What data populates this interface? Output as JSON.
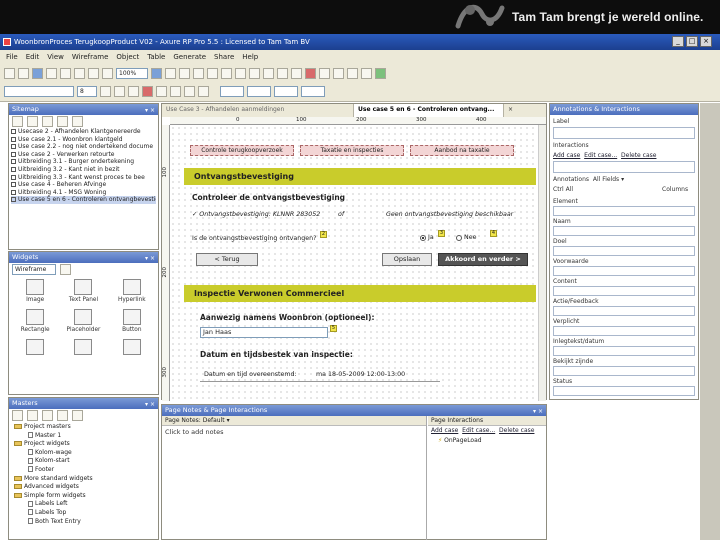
{
  "banner": {
    "tagline": "Tam Tam brengt je wereld online."
  },
  "window": {
    "title": "WoonbronProces TerugkoopProduct V02 - Axure RP Pro 5.5 : Licensed to Tam Tam BV",
    "controls": [
      "_",
      "□",
      "×"
    ]
  },
  "menu": [
    "File",
    "Edit",
    "View",
    "Wireframe",
    "Object",
    "Table",
    "Generate",
    "Share",
    "Help"
  ],
  "toolbar": {
    "zoom": "100%",
    "font_size": "8"
  },
  "sitemap": {
    "title": "Sitemap",
    "items": [
      "Usecase 2 - Afhandelen Klantgenereerde",
      "Use case 2.1 - Woonbron klantgeld",
      "Use case 2.2 - nog niet ondertekend docume",
      "Use case 2 - Verwerken retourte",
      "Uitbreiding 3.1 - Burger ondertekening",
      "Uitbreiding 3.2 - Kant niet in bezit",
      "Uitbreiding 3.3 - Kant wenst proces te bee",
      "Use case 4 - Beheren Afvinge",
      "Uitbreiding 4.1 - MSG Woning",
      "Use case 5 en 6 - Controleren ontvangbevestig"
    ],
    "selected_index": 9
  },
  "widgets": {
    "title": "Widgets",
    "library": "Wireframe",
    "items": [
      "Image",
      "Text Panel",
      "Hyperlink",
      "Rectangle",
      "Placeholder",
      "Button",
      "",
      "",
      ""
    ]
  },
  "masters": {
    "title": "Masters",
    "items": [
      {
        "type": "folder",
        "label": "Project masters"
      },
      {
        "type": "page",
        "label": "Master 1"
      },
      {
        "type": "folder",
        "label": "Project widgets"
      },
      {
        "type": "page",
        "label": "Kolom-wage"
      },
      {
        "type": "page",
        "label": "Kolom-start"
      },
      {
        "type": "page",
        "label": "Footer"
      },
      {
        "type": "folder",
        "label": "More standard widgets"
      },
      {
        "type": "folder",
        "label": "Advanced widgets"
      },
      {
        "type": "folder",
        "label": "Simple form widgets"
      },
      {
        "type": "page",
        "label": "Labels Left"
      },
      {
        "type": "page",
        "label": "Labels Top"
      },
      {
        "type": "page",
        "label": "Both Text Entry"
      }
    ]
  },
  "editor": {
    "tabs": [
      {
        "label": "Use Case 3 - Afhandelen aanmeldingen",
        "active": false
      },
      {
        "label": "Use case 5 en 6 - Controleren ontvang...",
        "active": true
      }
    ],
    "ruler_h": [
      "0",
      "100",
      "200",
      "300",
      "400"
    ],
    "ruler_v": [
      "100",
      "200",
      "300"
    ],
    "canvas": {
      "breadcrumbs": [
        "Controle terugkoopverzoek",
        "Taxatie en inspecties",
        "Aanbod na taxatie"
      ],
      "section1": "Ontvangstbevestiging",
      "heading1": "Controleer de ontvangstbevestiging",
      "status_ok": "✓ Ontvangstbevestiging: KLNNR 283052",
      "status_count": "of",
      "status_none": "Geen ontvangstbevestiging beschikbaar",
      "question": "Is de ontvangstbevestiging ontvangen?",
      "yes": "Ja",
      "no": "Nee",
      "btn_back": "< Terug",
      "btn_save": "Opslaan",
      "btn_next": "Akkoord en verder >",
      "section2": "Inspectie Verwonen Commercieel",
      "heading2": "Aanwezig namens Woonbron (optioneel):",
      "name_value": "Jan Haas",
      "datetime_label": "Datum en tijdsbestek van inspectie:",
      "datetime_row_label": "Datum en tijd overeenstemd:",
      "datetime_value": "ma 18-05-2009 12:00-13:00"
    }
  },
  "annotations": {
    "title": "Annotations & Interactions",
    "label_field": "Label",
    "interactions": "Interactions",
    "interaction_links": [
      "Add case",
      "Edit case...",
      "Delete case"
    ],
    "annotation_header": "Annotations",
    "annotation_filter": "All Fields",
    "column_left": "Ctrl All",
    "column_right": "Columns",
    "fields": [
      "Element",
      "Naam",
      "Doel",
      "Voorwaarde",
      "Content",
      "Actie/Feedback",
      "Verplicht",
      "Inlegtekst/datum",
      "Bekijkt zijnde",
      "Status"
    ]
  },
  "notes": {
    "title": "Page Notes & Page Interactions",
    "notes_header": "Page Notes",
    "notes_default": "Default",
    "notes_placeholder": "Click to add notes",
    "interactions_header": "Page Interactions",
    "interaction_links": [
      "Add case",
      "Edit case...",
      "Delete case"
    ],
    "interaction_item": "OnPageLoad"
  }
}
